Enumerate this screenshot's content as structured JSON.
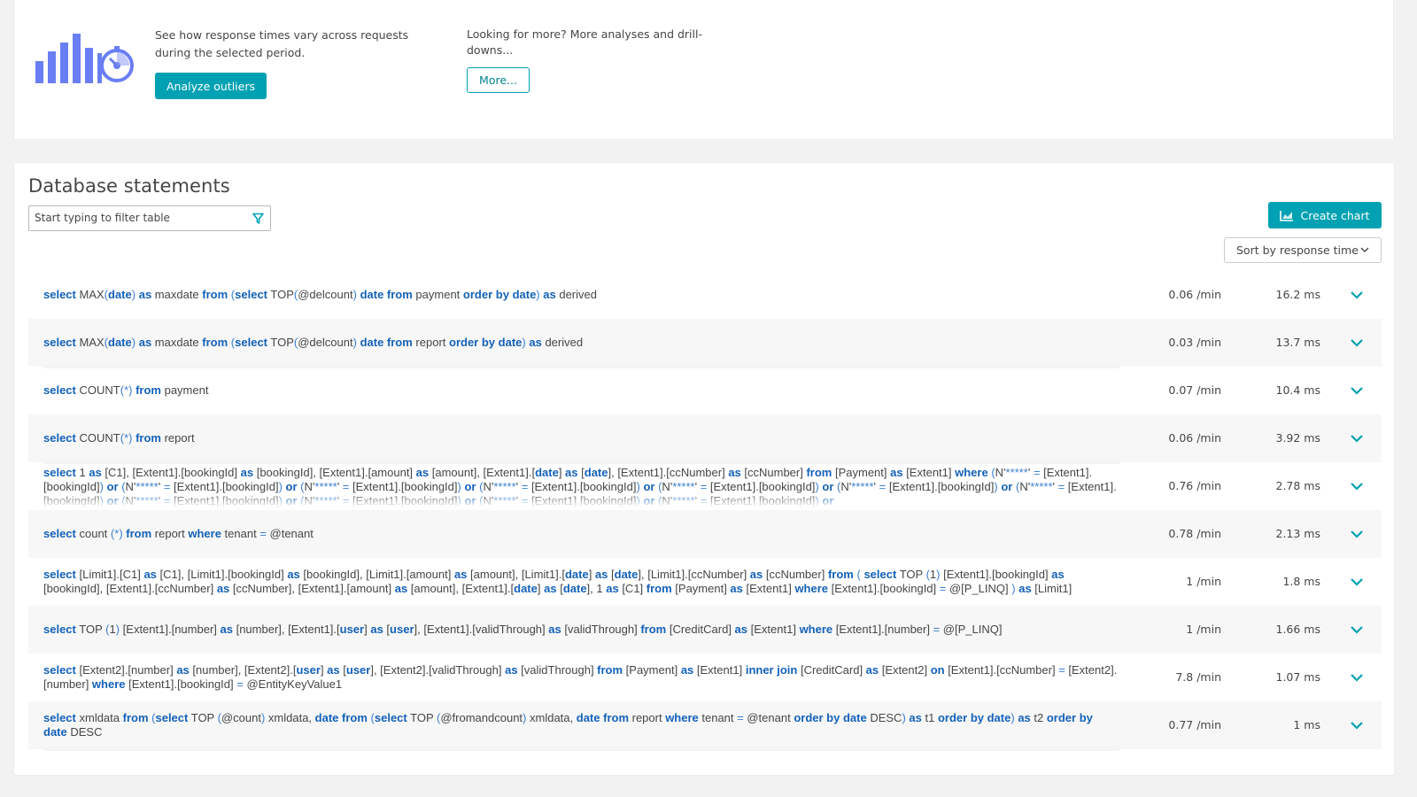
{
  "outliers": {
    "description": "See how response times vary across requests during the selected period.",
    "analyze_button": "Analyze outliers",
    "more_text": "Looking for more? More analyses and drill-downs...",
    "more_button": "More..."
  },
  "db": {
    "title": "Database statements",
    "filter_placeholder": "Start typing to filter table",
    "create_chart_label": "Create chart",
    "sort_label": "Sort by response time",
    "rows": [
      {
        "rate": "0.06 /min",
        "time": "16.2 ms"
      },
      {
        "rate": "0.03 /min",
        "time": "13.7 ms"
      },
      {
        "rate": "0.07 /min",
        "time": "10.4 ms"
      },
      {
        "rate": "0.06 /min",
        "time": "3.92 ms"
      },
      {
        "rate": "0.76 /min",
        "time": "2.78 ms"
      },
      {
        "rate": "0.78 /min",
        "time": "2.13 ms"
      },
      {
        "rate": "1 /min",
        "time": "1.8 ms"
      },
      {
        "rate": "1 /min",
        "time": "1.66 ms"
      },
      {
        "rate": "7.8 /min",
        "time": "1.07 ms"
      },
      {
        "rate": "0.77 /min",
        "time": "1 ms"
      }
    ],
    "statements": [
      "select MAX(date) as maxdate from (select TOP(@delcount) date from payment order by date) as derived",
      "select MAX(date) as maxdate from (select TOP(@delcount) date from report order by date) as derived",
      "select COUNT(*) from payment",
      "select COUNT(*) from report",
      "select 1 as [C1], [Extent1].[bookingId] as [bookingId], [Extent1].[amount] as [amount], [Extent1].[date] as [date], [Extent1].[ccNumber] as [ccNumber] from [Payment] as [Extent1] where (N'*****' = [Extent1].[bookingId]) or (N'*****' = [Extent1].[bookingId]) or (N'*****' = [Extent1].[bookingId]) or (N'*****' = [Extent1].[bookingId]) or (N'*****' = [Extent1].[bookingId]) or (N'*****' = [Extent1].[bookingId]) or (N'*****' = [Extent1].[bookingId]) or (N'*****' = [Extent1].[bookingId]) or (N'*****' = [Extent1].[bookingId]) or (N'*****' = [Extent1].[bookingId]) or (N'*****' = [Extent1].[bookingId]) or",
      "select count (*) from report where tenant = @tenant",
      "select [Limit1].[C1] as [C1], [Limit1].[bookingId] as [bookingId], [Limit1].[amount] as [amount], [Limit1].[date] as [date], [Limit1].[ccNumber] as [ccNumber] from ( select TOP (1) [Extent1].[bookingId] as [bookingId], [Extent1].[ccNumber] as [ccNumber], [Extent1].[amount] as [amount], [Extent1].[date] as [date], 1 as [C1] from [Payment] as [Extent1] where [Extent1].[bookingId] = @[P_LINQ] ) as [Limit1]",
      "select TOP (1) [Extent1].[number] as [number], [Extent1].[user] as [user], [Extent1].[validThrough] as [validThrough] from [CreditCard] as [Extent1] where [Extent1].[number] = @[P_LINQ]",
      "select [Extent2].[number] as [number], [Extent2].[user] as [user], [Extent2].[validThrough] as [validThrough] from [Payment] as [Extent1] inner join [CreditCard] as [Extent2] on [Extent1].[ccNumber] = [Extent2].[number] where [Extent1].[bookingId] = @EntityKeyValue1",
      "select xmldata from (select TOP (@count) xmldata, date from (select TOP (@fromandcount) xmldata, date from report where tenant = @tenant order by date DESC) as t1 order by date) as t2 order by date DESC"
    ]
  },
  "colors": {
    "accent": "#00a1b2",
    "keyword": "#1361b9",
    "logo_bars": "#6a7ef3"
  }
}
